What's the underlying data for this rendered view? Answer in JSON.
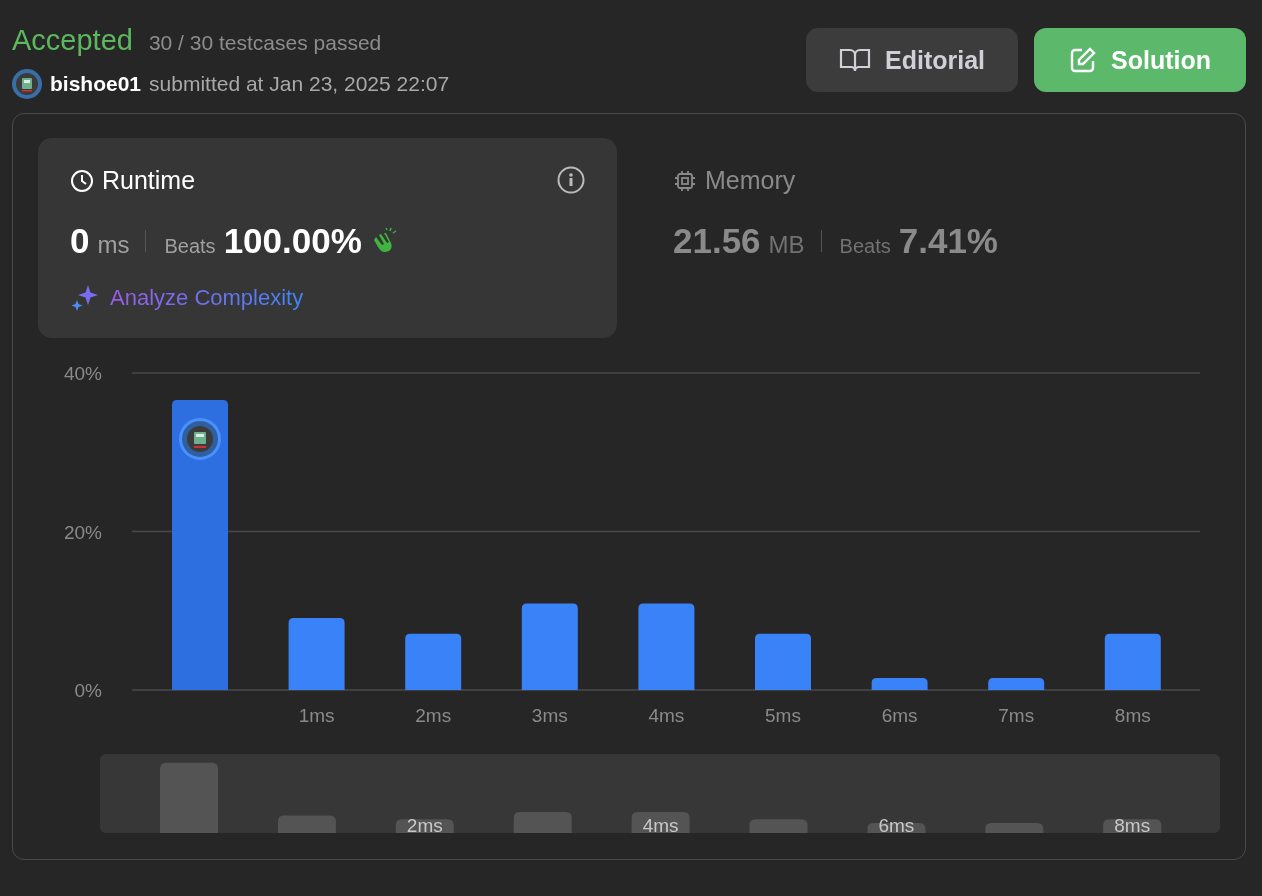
{
  "header": {
    "status": "Accepted",
    "testcases": "30 / 30 testcases passed",
    "user": "bishoe01",
    "submitted": "submitted at Jan 23, 2025 22:07"
  },
  "buttons": [
    {
      "kind": "editorial",
      "label": "Editorial"
    },
    {
      "kind": "solution",
      "label": "Solution"
    }
  ],
  "metrics": [
    {
      "kind": "runtime",
      "title": "Runtime",
      "value": "0",
      "unit": "ms",
      "beats_label": "Beats",
      "beats": "100.00%",
      "selected": true,
      "celebrate": true,
      "action": "Analyze Complexity"
    },
    {
      "kind": "memory",
      "title": "Memory",
      "value": "21.56",
      "unit": "MB",
      "beats_label": "Beats",
      "beats": "7.41%",
      "selected": false,
      "celebrate": false
    }
  ],
  "chart": {
    "chart_data": {
      "type": "bar",
      "categories": [
        null,
        "1ms",
        "2ms",
        "3ms",
        "4ms",
        "5ms",
        "6ms",
        "7ms",
        "8ms"
      ],
      "values": [
        36.6,
        9.1,
        7.1,
        10.9,
        10.9,
        7.1,
        1.5,
        1.5,
        7.1
      ],
      "ylim": [
        0,
        40
      ],
      "yticks": [
        {
          "value": 0,
          "label": "0%"
        },
        {
          "value": 20,
          "label": "20%"
        },
        {
          "value": 40,
          "label": "40%"
        }
      ]
    },
    "user_avatar": true
  },
  "overview": {
    "labels": [
      "2ms",
      "4ms",
      "6ms",
      "8ms"
    ]
  }
}
